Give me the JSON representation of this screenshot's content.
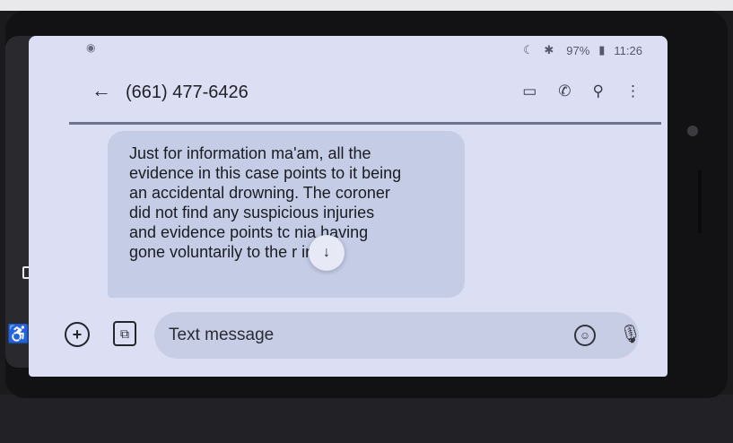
{
  "status_bar": {
    "icons": "☾ ✱",
    "battery": "97%",
    "battery_glyph": "▮",
    "time": "11:26"
  },
  "header": {
    "back_icon": "←",
    "title": "(661) 477-6426",
    "actions": [
      {
        "name": "video-call-icon",
        "glyph": "▭"
      },
      {
        "name": "phone-icon",
        "glyph": "✆"
      },
      {
        "name": "search-icon",
        "glyph": "⚲"
      },
      {
        "name": "more-icon",
        "glyph": "⋮"
      }
    ]
  },
  "message": {
    "lines": [
      "Just for information ma'am, all the",
      "evidence in this case points to it being",
      "an accidental drowning. The coroner",
      "did not find any suspicious injuries",
      "and evidence points tc nia having",
      "gone voluntarily to the r in her"
    ]
  },
  "scroll_button_glyph": "↓",
  "compose": {
    "placeholder": "Text message",
    "plus_glyph": "+",
    "gallery_glyph": "⧉",
    "emoji_glyph": "☺",
    "mic_glyph": "🎙"
  },
  "nav": {
    "back_glyph": "◁",
    "accessibility_glyph": "♿"
  }
}
